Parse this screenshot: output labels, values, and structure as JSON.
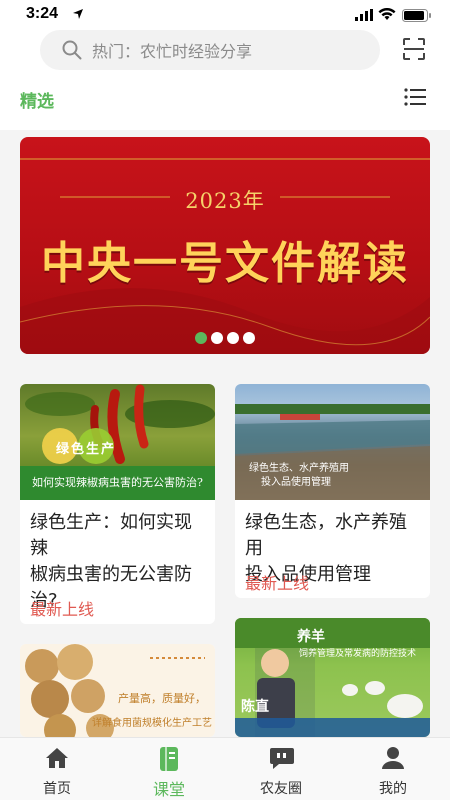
{
  "status_bar": {
    "time": "3:24"
  },
  "search": {
    "placeholder": "热门：农忙时经验分享"
  },
  "header": {
    "featured_tab": "精选"
  },
  "banner": {
    "year": "2023年",
    "title": "中央一号文件解读",
    "dots": 4,
    "active_dot": 0
  },
  "cards": [
    {
      "image_caption": "如何实现辣椒病虫害的无公害防治?",
      "image_tag": "绿色生产",
      "title_line1": "绿色生产：如何实现辣",
      "title_line2": "椒病虫害的无公害防",
      "title_line3": "治?",
      "badge": "最新上线"
    },
    {
      "image_caption_line1": "绿色生态、水产养殖用",
      "image_caption_line2": "投入品使用管理",
      "title_line1": "绿色生态，水产养殖用",
      "title_line2": "投入品使用管理",
      "badge": "最新上线"
    },
    {
      "image_text_line1": "产量高，质量好，",
      "image_text_line2": "详解食用菌规模化生产工艺"
    },
    {
      "image_title_line1": "养羊",
      "image_title_line2": "饲养管理及常发病的防控技术",
      "image_person": "陈直"
    }
  ],
  "tabbar": {
    "items": [
      {
        "label": "首页",
        "icon": "home-icon"
      },
      {
        "label": "课堂",
        "icon": "book-icon"
      },
      {
        "label": "农友圈",
        "icon": "chat-icon"
      },
      {
        "label": "我的",
        "icon": "profile-icon"
      }
    ],
    "active": 1
  },
  "colors": {
    "accent": "#5cb85c",
    "badge": "#e05a52",
    "banner_red": "#c8131a",
    "banner_gold": "#ffd35a"
  }
}
